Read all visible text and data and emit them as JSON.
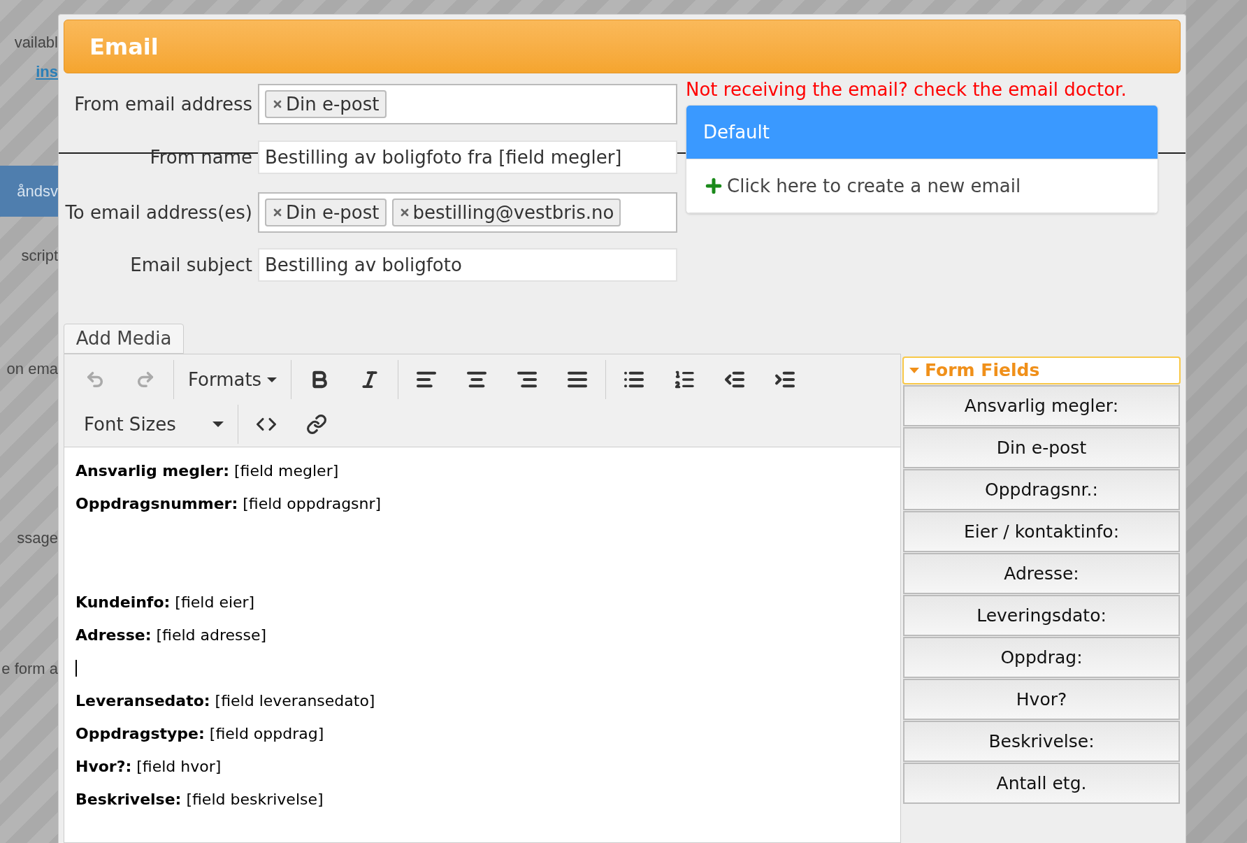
{
  "background_items": [
    {
      "kind": "text",
      "text": "vailabl"
    },
    {
      "kind": "link",
      "text": "ins"
    },
    {
      "kind": "highlight",
      "text": "åndsv"
    },
    {
      "kind": "text",
      "text": "script"
    },
    {
      "kind": "text",
      "text": "on ema"
    },
    {
      "kind": "text",
      "text": "ssage"
    },
    {
      "kind": "text",
      "text": "e form a"
    }
  ],
  "dialog": {
    "title": "Email",
    "notice": "Not receiving the email? check the email doctor.",
    "fields": [
      {
        "label": "From email address",
        "kind": "tags",
        "tags": [
          "Din e-post"
        ]
      },
      {
        "label": "From name",
        "kind": "text",
        "value": "Bestilling av boligfoto fra [field megler]"
      },
      {
        "label": "To email address(es)",
        "kind": "tags",
        "tags": [
          "Din e-post",
          "bestilling@vestbris.no"
        ]
      },
      {
        "label": "Email subject",
        "kind": "text",
        "value": "Bestilling av boligfoto"
      }
    ],
    "email_menu": [
      {
        "kind": "option",
        "label": "Default",
        "selected": true
      },
      {
        "kind": "create",
        "label": "Click here to create a new email",
        "selected": false
      }
    ],
    "add_media": "Add Media",
    "toolbar": {
      "history": [
        {
          "disabled": true
        },
        {
          "disabled": true
        }
      ],
      "formats": "Formats",
      "font_sizes": "Font Sizes"
    },
    "editor_lines": [
      {
        "kind": "text",
        "text": "**Ansvarlig megler:** [field megler]"
      },
      {
        "kind": "text",
        "text": "**Oppdragsnummer:** [field oppdragsnr]"
      },
      {
        "kind": "blank"
      },
      {
        "kind": "blank"
      },
      {
        "kind": "text",
        "text": "**Kundeinfo:** [field eier]"
      },
      {
        "kind": "text",
        "text": "**Adresse:** [field adresse]"
      },
      {
        "kind": "cursor"
      },
      {
        "kind": "text",
        "text": "**Leveransedato:** [field leveransedato]"
      },
      {
        "kind": "text",
        "text": "**Oppdragstype:** [field oppdrag]"
      },
      {
        "kind": "text",
        "text": "**Hvor?:** [field hvor]"
      },
      {
        "kind": "text",
        "text": "**Beskrivelse:** [field beskrivelse]"
      }
    ],
    "form_fields": {
      "title": "Form Fields",
      "expanded": true,
      "items": [
        "Ansvarlig megler:",
        "Din e-post",
        "Oppdragsnr.:",
        "Eier / kontaktinfo:",
        "Adresse:",
        "Leveringsdato:",
        "Oppdrag:",
        "Hvor?",
        "Beskrivelse:",
        "Antall etg."
      ]
    }
  }
}
